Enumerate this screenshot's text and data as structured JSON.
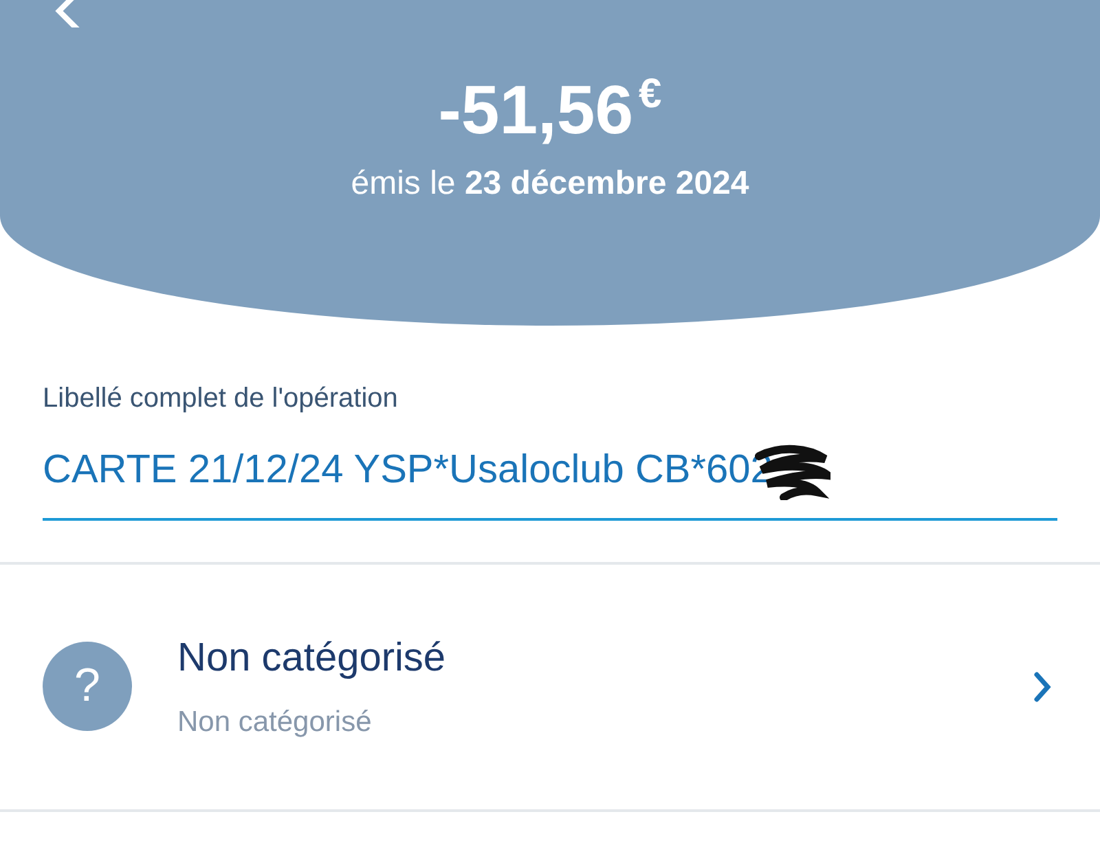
{
  "header": {
    "amount": "-51,56",
    "currency": "€",
    "date_line": "émis le **23 décembre 2024**"
  },
  "label_field": {
    "label": "Libellé complet de l'opération",
    "value": "CARTE 21/12/24 YSP*Usaloclub CB*602"
  },
  "category": {
    "icon_glyph": "?",
    "title": "Non catégorisé",
    "subtitle": "Non catégorisé"
  }
}
